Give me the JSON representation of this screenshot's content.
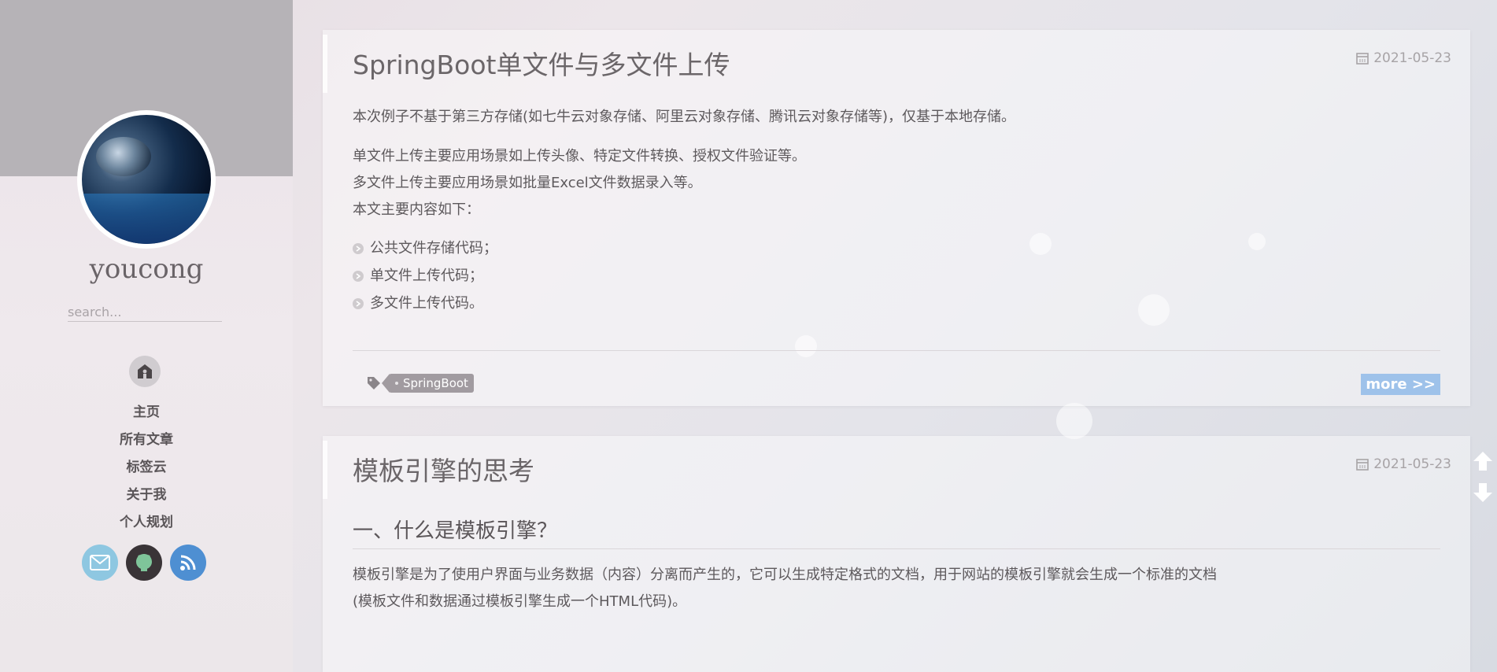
{
  "sidebar": {
    "site_name": "youcong",
    "search_placeholder": "search...",
    "nav": [
      {
        "label": "主页"
      },
      {
        "label": "所有文章"
      },
      {
        "label": "标签云"
      },
      {
        "label": "关于我"
      },
      {
        "label": "个人规划"
      }
    ],
    "socials": [
      "mail-icon",
      "github-icon",
      "rss-icon"
    ]
  },
  "posts": [
    {
      "title": "SpringBoot单文件与多文件上传",
      "date": "2021-05-23",
      "paragraphs": [
        "本次例子不基于第三方存储(如七牛云对象存储、阿里云对象存储、腾讯云对象存储等)，仅基于本地存储。",
        "单文件上传主要应用场景如上传头像、特定文件转换、授权文件验证等。",
        "多文件上传主要应用场景如批量Excel文件数据录入等。",
        "本文主要内容如下："
      ],
      "list": [
        "公共文件存储代码；",
        "单文件上传代码；",
        "多文件上传代码。"
      ],
      "tags": [
        "SpringBoot"
      ],
      "more_label": "more >>"
    },
    {
      "title": "模板引擎的思考",
      "date": "2021-05-23",
      "section_heading": "一、什么是模板引擎？",
      "paragraphs": [
        "模板引擎是为了使用户界面与业务数据（内容）分离而产生的，它可以生成特定格式的文档，用于网站的模板引擎就会生成一个标准的文档",
        "(模板文件和数据通过模板引擎生成一个HTML代码)。"
      ]
    }
  ],
  "colors": {
    "more_button": "#9ec2ea",
    "tag": "#a19ba0",
    "mail": "#8ec7e1",
    "github": "#3a3437",
    "rss": "#4e8fd2"
  }
}
